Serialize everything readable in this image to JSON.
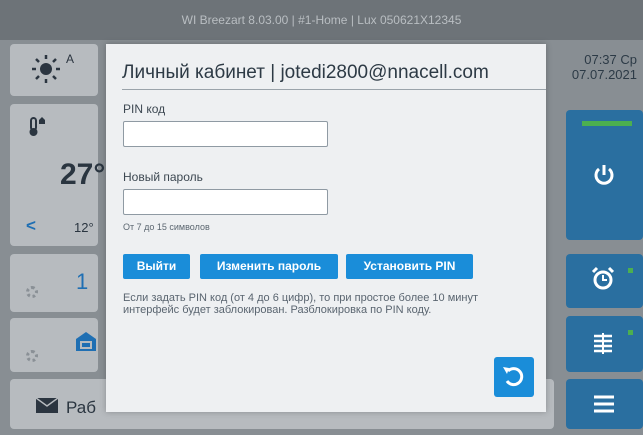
{
  "window": {
    "title": "WI Breezart 8.03.00 | #1-Home | Lux 050621X12345"
  },
  "header": {
    "time": "07:37 Ср",
    "date": "07.07.2021"
  },
  "background": {
    "weather_letter": "A",
    "temperature": "27°",
    "temperature_small": "12°",
    "fan_speed": "1",
    "mode_label": "Раб"
  },
  "dialog": {
    "title": "Личный кабинет | jotedi2800@nnacell.com",
    "pin_label": "PIN код",
    "pin_value": "",
    "new_password_label": "Новый пароль",
    "new_password_value": "",
    "password_hint": "От 7 до 15 символов",
    "logout_label": "Выйти",
    "change_password_label": "Изменить пароль",
    "set_pin_label": "Установить PIN",
    "info_text": "Если задать PIN код (от 4 до 6 цифр), то при простое более 10 минут интерфейс будет заблокирован. Разблокировка по PIN коду."
  },
  "colors": {
    "accent": "#1a8dd9",
    "tile_blue": "#2a6fa0",
    "indicator_green": "#4caf50"
  }
}
